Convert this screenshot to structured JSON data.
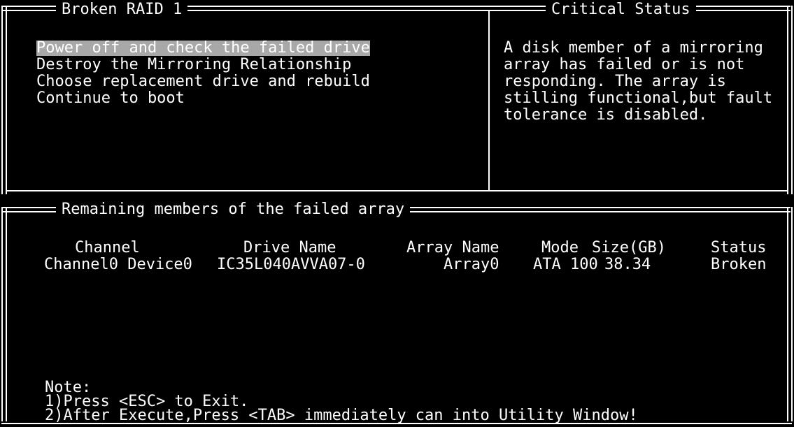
{
  "top_left_panel": {
    "title": "Broken RAID 1",
    "menu": [
      "Power off and check the failed drive",
      "Destroy the Mirroring Relationship",
      "Choose replacement drive and rebuild",
      "Continue to boot"
    ]
  },
  "top_right_panel": {
    "title": "Critical Status",
    "lines": [
      "A disk member of a mirroring",
      "array has failed or is not",
      "responding. The array is",
      "stilling functional,but fault",
      "tolerance is disabled."
    ]
  },
  "bottom_panel": {
    "title": "Remaining members of the failed array",
    "columns": [
      "Channel",
      "Drive Name",
      "Array Name",
      "Mode",
      "Size(GB)",
      "Status"
    ],
    "rows": [
      [
        "Channel0 Device0",
        "IC35L040AVVA07-0",
        "Array0",
        "ATA 100",
        "38.34",
        "Broken"
      ]
    ],
    "note_label": "Note:",
    "notes": [
      "1)Press <ESC> to Exit.",
      "2)After Execute,Press <TAB> immediately can into Utility Window!"
    ]
  }
}
